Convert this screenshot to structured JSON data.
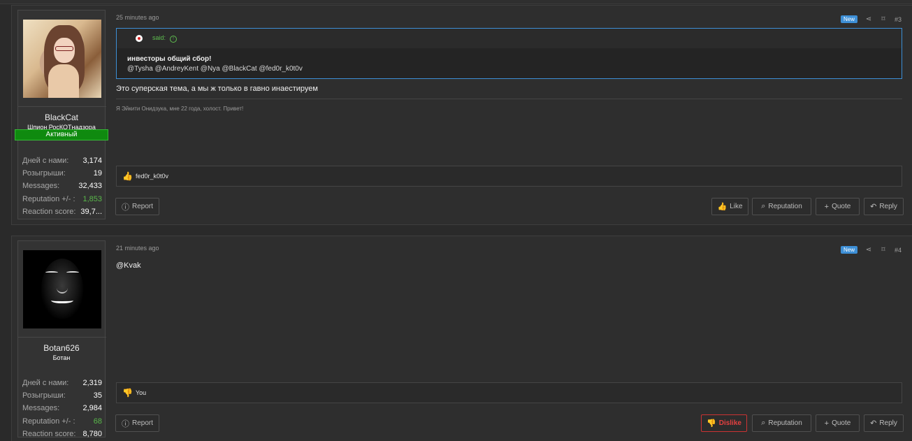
{
  "posts": [
    {
      "time": "25 minutes ago",
      "badge_new": "New",
      "number": "#3",
      "user": {
        "name": "BlackCat",
        "title": "Шпион РосКОТнадзора",
        "badge": "Активный"
      },
      "stats": [
        {
          "label": "Дней с нами:",
          "value": "3,174"
        },
        {
          "label": "Розыгрыши:",
          "value": "19"
        },
        {
          "label": "Messages:",
          "value": "32,433"
        },
        {
          "label": "Reputation +/- :",
          "value": "1,853"
        },
        {
          "label": "Reaction score:",
          "value": "39,7..."
        }
      ],
      "quote": {
        "said": "said:",
        "title": "инвесторы общий сбор!",
        "mentions": "@Tysha @AndreyKent @Nya @BlackCat @fed0r_k0t0v"
      },
      "body": "Это суперская тема, а мы ж только в гавно инаестируем",
      "signature": "Я Эйкити Онидзука, мне 22 года, холост. Привет!",
      "reaction_users": "fed0r_k0t0v",
      "actions": {
        "report": "Report",
        "like": "Like",
        "reputation": "Reputation",
        "quote": "Quote",
        "reply": "Reply"
      }
    },
    {
      "time": "21 minutes ago",
      "badge_new": "New",
      "number": "#4",
      "user": {
        "name": "Botan626",
        "title": "Ботан"
      },
      "stats": [
        {
          "label": "Дней с нами:",
          "value": "2,319"
        },
        {
          "label": "Розыгрыши:",
          "value": "35"
        },
        {
          "label": "Messages:",
          "value": "2,984"
        },
        {
          "label": "Reputation +/- :",
          "value": "68"
        },
        {
          "label": "Reaction score:",
          "value": "8,780"
        }
      ],
      "body": "@Kvak",
      "reaction_users": "You",
      "actions": {
        "report": "Report",
        "dislike": "Dislike",
        "reputation": "Reputation",
        "quote": "Quote",
        "reply": "Reply"
      }
    }
  ],
  "colors": {
    "accent": "#3d8fd6",
    "positive": "#59b84a",
    "active_badge": "#0f8a0f",
    "dislike": "#e34040"
  }
}
